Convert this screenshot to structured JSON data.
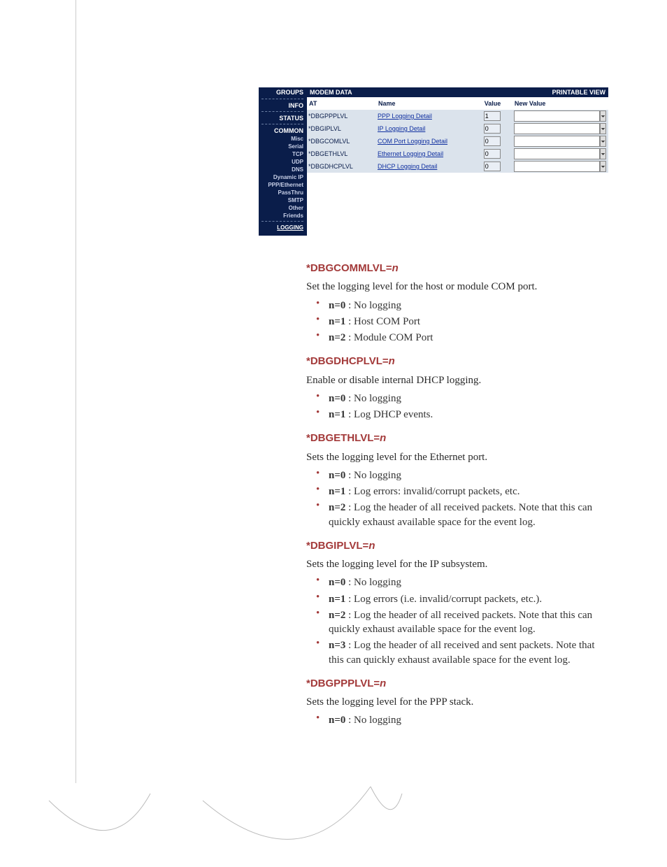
{
  "panel": {
    "left_header": "GROUPS",
    "banner_left": "MODEM DATA",
    "banner_right": "PRINTABLE VIEW",
    "sidebar": [
      {
        "type": "sep"
      },
      {
        "type": "section",
        "label": "INFO"
      },
      {
        "type": "sep"
      },
      {
        "type": "section",
        "label": "STATUS"
      },
      {
        "type": "sep"
      },
      {
        "type": "section",
        "label": "COMMON"
      },
      {
        "type": "item",
        "label": "Misc"
      },
      {
        "type": "item",
        "label": "Serial"
      },
      {
        "type": "item",
        "label": "TCP"
      },
      {
        "type": "item",
        "label": "UDP"
      },
      {
        "type": "item",
        "label": "DNS"
      },
      {
        "type": "item",
        "label": "Dynamic IP"
      },
      {
        "type": "item",
        "label": "PPP/Ethernet"
      },
      {
        "type": "item",
        "label": "PassThru"
      },
      {
        "type": "item",
        "label": "SMTP"
      },
      {
        "type": "item",
        "label": "Other"
      },
      {
        "type": "item",
        "label": "Friends"
      },
      {
        "type": "sep"
      },
      {
        "type": "active",
        "label": "LOGGING"
      }
    ],
    "columns": {
      "at": "AT",
      "name": "Name",
      "value": "Value",
      "newvalue": "New Value"
    },
    "rows": [
      {
        "at": "*DBGPPPLVL",
        "name": "PPP Logging Detail",
        "value": "1"
      },
      {
        "at": "*DBGIPLVL",
        "name": "IP Logging Detail",
        "value": "0"
      },
      {
        "at": "*DBGCOMLVL",
        "name": "COM Port Logging Detail",
        "value": "0"
      },
      {
        "at": "*DBGETHLVL",
        "name": "Ethernet Logging Detail",
        "value": "0"
      },
      {
        "at": "*DBGDHCPLVL",
        "name": "DHCP Logging Detail",
        "value": "0"
      }
    ]
  },
  "sections": [
    {
      "cmd_prefix": "*DBGCOMMLVL=",
      "cmd_var": "n",
      "desc": "Set the logging level for the host or module COM port.",
      "opts": [
        {
          "key": "n=0",
          "text": " : No logging"
        },
        {
          "key": "n=1",
          "text": " : Host COM Port"
        },
        {
          "key": "n=2",
          "text": " : Module COM Port"
        }
      ]
    },
    {
      "cmd_prefix": "*DBGDHCPLVL=",
      "cmd_var": "n",
      "desc": "Enable or disable internal DHCP logging.",
      "opts": [
        {
          "key": "n=0",
          "text": " : No logging"
        },
        {
          "key": "n=1",
          "text": " : Log DHCP events."
        }
      ]
    },
    {
      "cmd_prefix": "*DBGETHLVL=",
      "cmd_var": "n",
      "desc": "Sets the logging level for the Ethernet port.",
      "opts": [
        {
          "key": "n=0",
          "text": " : No logging"
        },
        {
          "key": "n=1",
          "text": " : Log errors: invalid/corrupt packets, etc."
        },
        {
          "key": "n=2",
          "text": " : Log the header of all received packets. Note that this can quickly exhaust available space for the event log."
        }
      ]
    },
    {
      "cmd_prefix": "*DBGIPLVL=",
      "cmd_var": "n",
      "desc": "Sets the logging level for the IP subsystem.",
      "opts": [
        {
          "key": "n=0",
          "text": " : No logging"
        },
        {
          "key": "n=1",
          "text": " : Log errors (i.e. invalid/corrupt packets, etc.)."
        },
        {
          "key": "n=2",
          "text": " : Log the header of all received packets. Note that this can quickly exhaust available space for the event log."
        },
        {
          "key": "n=3",
          "text": " : Log the header of all received and sent packets. Note that this can quickly exhaust available space for the event log."
        }
      ]
    },
    {
      "cmd_prefix": "*DBGPPPLVL=",
      "cmd_var": "n",
      "desc": "Sets the logging level for the PPP stack.",
      "opts": [
        {
          "key": "n=0",
          "text": " : No logging"
        }
      ]
    }
  ]
}
